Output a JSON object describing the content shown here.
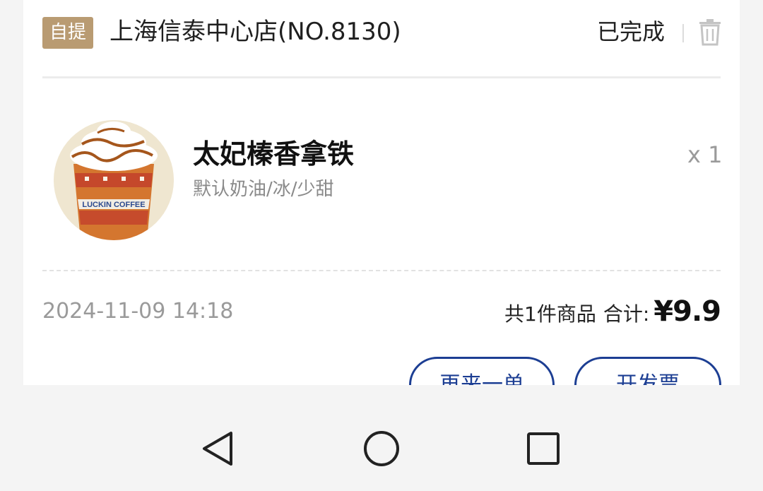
{
  "order": {
    "pickup_badge": "自提",
    "store_name": "上海信泰中心店(NO.8130)",
    "status": "已完成",
    "delete_icon": "trash-icon"
  },
  "item": {
    "name": "太妃榛香拿铁",
    "spec": "默认奶油/冰/少甜",
    "quantity": "x 1",
    "cup_text": "LUCKIN COFFEE"
  },
  "summary": {
    "time": "2024-11-09 14:18",
    "count_text": "共1件商品",
    "total_label": "合计:",
    "amount": "¥9.9"
  },
  "actions": {
    "reorder": "再来一单",
    "invoice": "开发票"
  },
  "navbar": {
    "back_icon": "back-triangle-icon",
    "home_icon": "home-circle-icon",
    "recents_icon": "recents-square-icon"
  },
  "colors": {
    "badge": "#b99b72",
    "button": "#1c3e93",
    "background": "#f4f4f4"
  }
}
